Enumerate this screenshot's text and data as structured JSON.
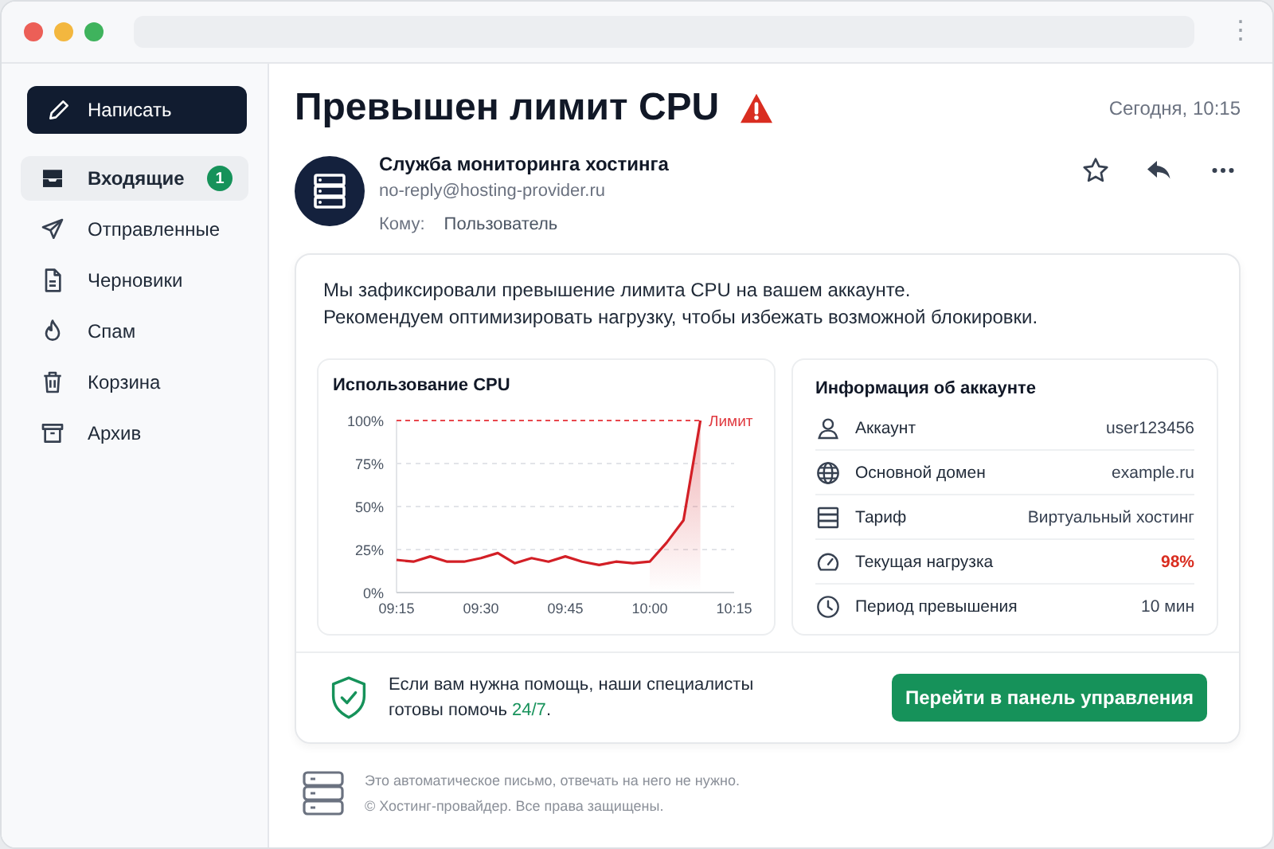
{
  "browser": {
    "menu": "⋮"
  },
  "sidebar": {
    "compose": "Написать",
    "items": [
      {
        "label": "Входящие",
        "selected": true,
        "badge": "1"
      },
      {
        "label": "Отправленные",
        "selected": false
      },
      {
        "label": "Черновики",
        "selected": false
      },
      {
        "label": "Спам",
        "selected": false
      },
      {
        "label": "Корзина",
        "selected": false
      },
      {
        "label": "Архив",
        "selected": false
      }
    ]
  },
  "message": {
    "subject": "Превышен лимит CPU",
    "date": "Сегодня, 10:15",
    "sender": "Служба мониторинга хостинга",
    "email": "no-reply@hosting-provider.ru",
    "to_label": "Кому:",
    "to": "Пользователь",
    "starred": false,
    "body": [
      "Мы зафиксировали превышение лимита CPU на вашем аккаунте.",
      "Рекомендуем оптимизировать нагрузку, чтобы избежать возможной блокировки."
    ],
    "chart": {
      "title": "Использование CPU",
      "chart_data": {
        "type": "line",
        "ylim": [
          0,
          100
        ],
        "categories": [
          "09:15",
          null,
          null,
          null,
          null,
          "09:30",
          null,
          null,
          null,
          null,
          "09:45",
          null,
          null,
          null,
          null,
          "10:00",
          null,
          null,
          null,
          null,
          "10:15"
        ],
        "yticks": [
          {
            "value": 0,
            "label": "0%"
          },
          {
            "value": 25,
            "label": "25%"
          },
          {
            "value": 50,
            "label": "50%"
          },
          {
            "value": 75,
            "label": "75%"
          },
          {
            "value": 100,
            "label": "100%"
          }
        ],
        "series": [
          {
            "color": "#d31f26",
            "values": [
              19,
              18,
              21,
              18,
              18,
              20,
              23,
              17,
              20,
              18,
              21,
              18,
              16,
              18,
              17,
              18,
              29,
              42,
              100,
              null,
              null
            ]
          }
        ],
        "grid": true,
        "ref_lines": [
          {
            "axis": "y",
            "value": 100,
            "label": "Лимит"
          }
        ]
      }
    },
    "account": {
      "title": "Информация об аккаунте",
      "rows": [
        {
          "label": "Аккаунт",
          "value": "user123456",
          "alert": false
        },
        {
          "label": "Основной домен",
          "value": "example.ru",
          "alert": false
        },
        {
          "label": "Тариф",
          "value": "Виртуальный хостинг",
          "alert": false
        },
        {
          "label": "Текущая нагрузка",
          "value": "98%",
          "alert": true
        },
        {
          "label": "Период превышения",
          "value": "10 мин",
          "alert": false
        }
      ]
    },
    "help": {
      "text": "Если вам нужна помощь, наши специалисты готовы помочь",
      "highlight": "24/7",
      "end": "."
    },
    "action": "Перейти в панель управления"
  },
  "footer": [
    "Это автоматическое письмо, отвечать на него не нужно.",
    "© Хостинг-провайдер. Все права защищены."
  ]
}
